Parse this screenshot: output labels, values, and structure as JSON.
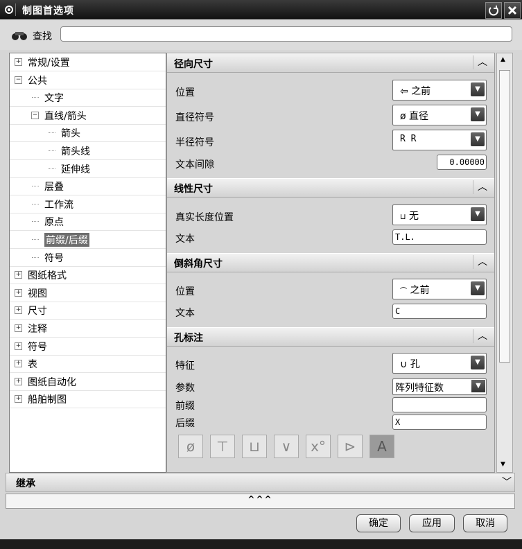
{
  "window": {
    "title": "制图首选项"
  },
  "search": {
    "label": "查找",
    "value": ""
  },
  "tree": [
    {
      "label": "常规/设置",
      "expander": "+"
    },
    {
      "label": "公共",
      "expander": "-"
    },
    {
      "label": "文字"
    },
    {
      "label": "直线/箭头",
      "expander": "-"
    },
    {
      "label": "箭头"
    },
    {
      "label": "箭头线"
    },
    {
      "label": "延伸线"
    },
    {
      "label": "层叠"
    },
    {
      "label": "工作流"
    },
    {
      "label": "原点"
    },
    {
      "label": "前缀/后缀",
      "selected": true
    },
    {
      "label": "符号"
    },
    {
      "label": "图纸格式",
      "expander": "+"
    },
    {
      "label": "视图",
      "expander": "+"
    },
    {
      "label": "尺寸",
      "expander": "+"
    },
    {
      "label": "注释",
      "expander": "+"
    },
    {
      "label": "符号",
      "expander": "+"
    },
    {
      "label": "表",
      "expander": "+"
    },
    {
      "label": "图纸自动化",
      "expander": "+"
    },
    {
      "label": "船舶制图",
      "expander": "+"
    }
  ],
  "sections": {
    "radial": {
      "title": "径向尺寸",
      "position_label": "位置",
      "position_value": "之前",
      "dia_label": "直径符号",
      "dia_value": "直径",
      "dia_symbol": "ø",
      "rad_label": "半径符号",
      "rad_value": "R",
      "gap_label": "文本间隙",
      "gap_value": "0.00000"
    },
    "linear": {
      "title": "线性尺寸",
      "truelen_label": "真实长度位置",
      "truelen_value": "无",
      "text_label": "文本",
      "text_value": "T.L."
    },
    "chamfer": {
      "title": "倒斜角尺寸",
      "position_label": "位置",
      "position_value": "之前",
      "text_label": "文本",
      "text_value": "C"
    },
    "hole": {
      "title": "孔标注",
      "feature_label": "特征",
      "feature_value": "孔",
      "param_label": "参数",
      "param_value": "阵列特征数",
      "prefix_label": "前缀",
      "prefix_value": "",
      "suffix_label": "后缀",
      "suffix_value": "X"
    }
  },
  "symbols": [
    "ø",
    "⊤",
    "⊔",
    "∨",
    "x°",
    "⊳",
    "A"
  ],
  "inherit": {
    "title": "继承"
  },
  "collapse": "^^^",
  "buttons": {
    "ok": "确定",
    "apply": "应用",
    "cancel": "取消"
  }
}
